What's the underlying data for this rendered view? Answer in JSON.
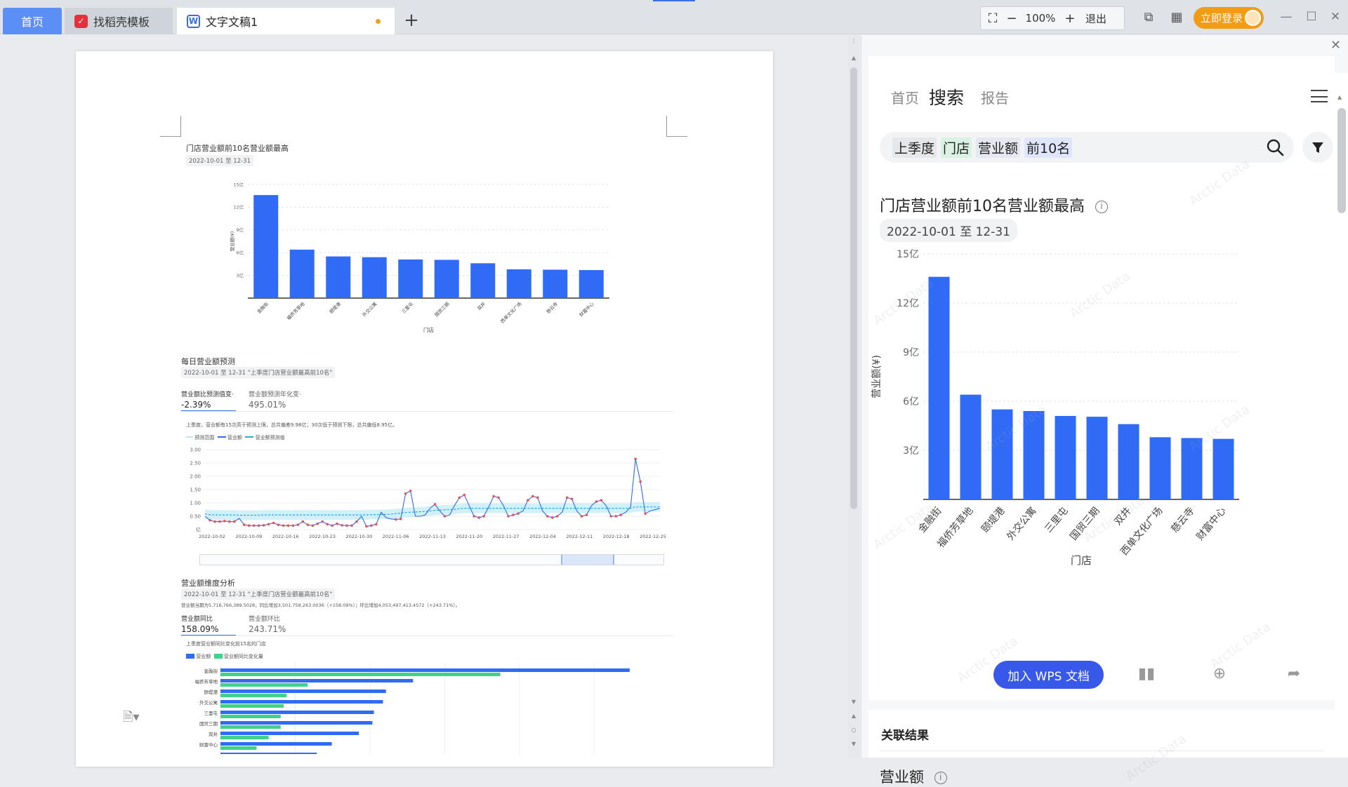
{
  "tabs": {
    "home": "首页",
    "daoke": "找稻壳模板",
    "doc": "文字文稿1",
    "add": "+"
  },
  "toolbar": {
    "zoom_value": "100%",
    "exit": "退出",
    "login": "立即登录"
  },
  "doc": {
    "chart1_title": "门店营业额前10名营业额最高",
    "chart1_date": "2022-10-01 至 12-31",
    "chart1_ylabel": "营业额(¥)",
    "chart1_xlabel": "门店",
    "forecast_title": "每日营业额预测",
    "forecast_chip": "2022-10-01 至 12-31 \"上季度门店营业额最高前10名\"",
    "kpi1_label": "营业额比预测值变·",
    "kpi1_value": "-2.39%",
    "kpi2_label": "营业额预测年化变·",
    "kpi2_value": "495.01%",
    "forecast_desc": "上季度，营业额有15次高于预测上限，总共偏差9.98亿；30次低于预测下限，总共偏低8.95亿。",
    "forecast_legend": [
      "预测范围",
      "营业额",
      "营业额预测值"
    ],
    "dim_title": "营业额维度分析",
    "dim_chip": "2022-10-01 至 12-31 \"上季度门店营业额最高前10名\"",
    "dim_desc": "营业额当期为5,716,766,389.5028，同比增加3,501,758,263.0036（+158.09%）；环比增加4,053,497,413.4572（+243.71%）。",
    "kpi3_label": "营业额同比",
    "kpi3_value": "158.09%",
    "kpi4_label": "营业额环比",
    "kpi4_value": "243.71%",
    "hbar_desc": "上季度营业额同比变化前15名的门店",
    "hbar_legend": [
      "营业额",
      "营业额同比变化量"
    ]
  },
  "panel": {
    "nav": [
      "首页",
      "搜索",
      "报告"
    ],
    "search_tokens": [
      {
        "text": "上季度",
        "kind": "time"
      },
      {
        "text": "门店",
        "kind": "dim"
      },
      {
        "text": "营业额",
        "kind": "measure"
      },
      {
        "text": "前10名",
        "kind": "rank"
      }
    ],
    "chart_title": "门店营业额前10名营业额最高",
    "date": "2022-10-01 至 12-31",
    "add_wps": "加入 WPS 文档",
    "related": "关联结果",
    "related_measure": "营业额",
    "watermark": "Arctic Data"
  },
  "chart_data": [
    {
      "type": "bar",
      "title": "门店营业额前10名营业额最高",
      "xlabel": "门店",
      "ylabel": "营业额(¥)",
      "categories": [
        "金融街",
        "福侨芳草地",
        "颐堤港",
        "外交公寓",
        "三里屯",
        "国贸三期",
        "双井",
        "西单文化广场",
        "慈云寺",
        "财富中心"
      ],
      "values": [
        13.6,
        6.4,
        5.5,
        5.4,
        5.1,
        5.05,
        4.6,
        3.8,
        3.75,
        3.7
      ],
      "y_ticks": [
        "3亿",
        "6亿",
        "9亿",
        "12亿",
        "15亿"
      ],
      "ylim": [
        0,
        15
      ],
      "color": "#2f6bf5"
    },
    {
      "type": "line",
      "title": "每日营业额预测",
      "x_ticks": [
        "2022-10-02",
        "2022-10-09",
        "2022-10-16",
        "2022-10-23",
        "2022-10-30",
        "2022-11-06",
        "2022-11-13",
        "2022-11-20",
        "2022-11-27",
        "2022-12-04",
        "2022-12-11",
        "2022-12-18",
        "2022-12-25"
      ],
      "y_ticks": [
        "亿",
        "0.50",
        "1.00",
        "1.50",
        "2.00",
        "2.50",
        "3.00"
      ],
      "ylim": [
        0,
        3
      ],
      "series": [
        {
          "name": "营业额",
          "values": [
            0.5,
            0.35,
            0.3,
            0.3,
            0.32,
            0.3,
            0.3,
            0.42,
            0.18,
            0.15,
            0.15,
            0.15,
            0.16,
            0.2,
            0.25,
            0.18,
            0.15,
            0.15,
            0.15,
            0.18,
            0.3,
            0.18,
            0.15,
            0.22,
            0.3,
            0.2,
            0.15,
            0.22,
            0.16,
            0.15,
            0.15,
            0.3,
            0.5,
            0.12,
            0.15,
            0.2,
            0.65,
            0.45,
            0.4,
            0.38,
            0.4,
            1.35,
            1.45,
            0.5,
            0.5,
            0.55,
            0.8,
            0.95,
            0.7,
            0.5,
            0.55,
            0.9,
            1.2,
            1.3,
            0.9,
            0.5,
            0.45,
            0.5,
            0.85,
            1.25,
            1.2,
            0.9,
            0.5,
            0.55,
            0.6,
            0.7,
            1.1,
            1.25,
            1.2,
            0.7,
            0.5,
            0.45,
            0.5,
            0.65,
            1.2,
            1.15,
            0.7,
            0.5,
            0.55,
            0.9,
            1.05,
            1.1,
            0.9,
            0.5,
            0.5,
            0.55,
            0.65,
            0.85,
            2.65,
            1.8,
            0.6,
            0.7,
            0.75,
            0.8
          ]
        },
        {
          "name": "营业额预测值",
          "values": [
            0.58,
            0.56,
            0.55,
            0.55,
            0.55,
            0.55,
            0.55,
            0.54,
            0.54,
            0.54,
            0.54,
            0.54,
            0.55,
            0.55,
            0.55,
            0.55,
            0.55,
            0.55,
            0.55,
            0.55,
            0.55,
            0.55,
            0.55,
            0.55,
            0.55,
            0.55,
            0.55,
            0.55,
            0.55,
            0.55,
            0.55,
            0.55,
            0.55,
            0.55,
            0.56,
            0.56,
            0.57,
            0.57,
            0.58,
            0.6,
            0.62,
            0.64,
            0.65,
            0.66,
            0.67,
            0.68,
            0.7,
            0.72,
            0.73,
            0.74,
            0.75,
            0.76,
            0.78,
            0.8,
            0.8,
            0.8,
            0.8,
            0.8,
            0.8,
            0.8,
            0.8,
            0.8,
            0.8,
            0.8,
            0.8,
            0.8,
            0.8,
            0.8,
            0.8,
            0.8,
            0.8,
            0.8,
            0.8,
            0.8,
            0.8,
            0.8,
            0.8,
            0.8,
            0.8,
            0.8,
            0.8,
            0.8,
            0.8,
            0.8,
            0.8,
            0.8,
            0.8,
            0.8,
            0.85,
            0.85,
            0.85,
            0.85,
            0.85,
            0.85
          ]
        }
      ]
    },
    {
      "type": "bar",
      "title": "上季度营业额同比变化前15名的门店",
      "categories": [
        "金融街",
        "福侨芳草地",
        "颐堤港",
        "外交公寓",
        "三里屯",
        "国贸三期",
        "双井",
        "财富中心",
        ""
      ],
      "series": [
        {
          "name": "营业额",
          "values": [
            13.6,
            6.4,
            5.5,
            5.4,
            5.1,
            5.05,
            4.6,
            3.7,
            3.2
          ]
        },
        {
          "name": "营业额同比变化量",
          "values": [
            9.3,
            2.9,
            2.2,
            2.1,
            2.0,
            2.0,
            1.6,
            1.2,
            0.9
          ]
        }
      ],
      "colors": [
        "#2f6bf5",
        "#3fd38a"
      ]
    }
  ]
}
